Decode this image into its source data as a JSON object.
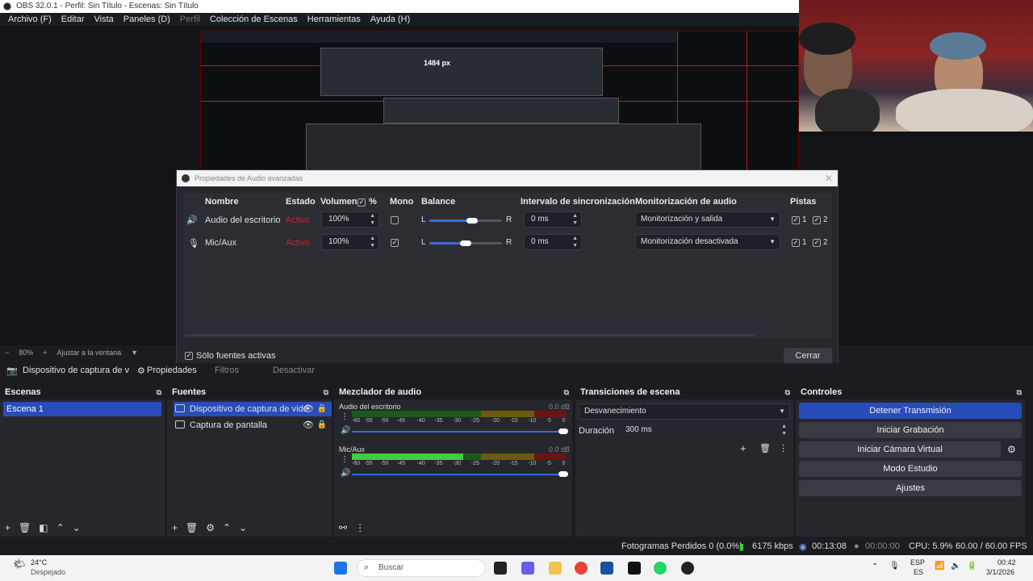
{
  "window": {
    "title": "OBS 32.0.1 - Perfil: Sin Título - Escenas: Sin Título"
  },
  "menu": [
    {
      "label": "Archivo (F)",
      "enabled": true
    },
    {
      "label": "Editar",
      "enabled": true
    },
    {
      "label": "Vista",
      "enabled": true
    },
    {
      "label": "Paneles (D)",
      "enabled": true
    },
    {
      "label": "Perfil",
      "enabled": false
    },
    {
      "label": "Colección de Escenas",
      "enabled": true
    },
    {
      "label": "Herramientas",
      "enabled": true
    },
    {
      "label": "Ayuda (H)",
      "enabled": true
    }
  ],
  "preview": {
    "nested_label": "1484 px",
    "zoom": "80%",
    "fit_label": "Ajustar a la ventana"
  },
  "audio_dialog": {
    "title": "Propiedades de Audio avanzadas",
    "columns": {
      "name": "Nombre",
      "state": "Estado",
      "volume": "Volumen",
      "percent": "%",
      "mono": "Mono",
      "balance": "Balance",
      "sync": "Intervalo de sincronización",
      "monitoring": "Monitorización de audio",
      "tracks": "Pistas"
    },
    "rows": [
      {
        "icon": "speaker-icon",
        "name": "Audio del escritorio",
        "state": "Activo",
        "volume": "100%",
        "mono": false,
        "balance_l": "L",
        "balance_r": "R",
        "balance": 0.5,
        "sync": "0 ms",
        "monitoring": "Monitorización y salida",
        "track1": "1",
        "track2": "2"
      },
      {
        "icon": "microphone-icon",
        "name": "Mic/Aux",
        "state": "Activo",
        "volume": "100%",
        "mono": true,
        "balance_l": "L",
        "balance_r": "R",
        "balance": 0.5,
        "sync": "0 ms",
        "monitoring": "Monitorización desactivada",
        "track1": "1",
        "track2": "2"
      }
    ],
    "only_active_label": "Sólo fuentes activas",
    "close_label": "Cerrar"
  },
  "source_toolbar": {
    "selected_source": "Dispositivo de captura de v",
    "properties": "Propiedades",
    "filters": "Filtros",
    "deactivate": "Desactivar"
  },
  "scenes": {
    "title": "Escenas",
    "items": [
      "Escena 1"
    ]
  },
  "sources": {
    "title": "Fuentes",
    "items": [
      {
        "name": "Dispositivo de captura de vide",
        "icon": "camera-icon"
      },
      {
        "name": "Captura de pantalla",
        "icon": "monitor-icon"
      }
    ]
  },
  "mixer": {
    "title": "Mezclador de audio",
    "ticks": [
      "-60",
      "-55",
      "-50",
      "-45",
      "-40",
      "-35",
      "-30",
      "-25",
      "-20",
      "-15",
      "-10",
      "-5",
      "0"
    ],
    "channels": [
      {
        "name": "Audio del escritorio",
        "db": "0.0 dB",
        "level": 0.0
      },
      {
        "name": "Mic/Aux",
        "db": "0.0 dB",
        "level": 0.52
      }
    ]
  },
  "transitions": {
    "title": "Transiciones de escena",
    "selected": "Desvanecimiento",
    "duration_label": "Duración",
    "duration_value": "300 ms"
  },
  "controls": {
    "title": "Controles",
    "stop_streaming": "Detener Transmisión",
    "start_recording": "Iniciar Grabación",
    "start_virtual_cam": "Iniciar Cámara Virtual",
    "studio_mode": "Modo Estudio",
    "settings": "Ajustes"
  },
  "status": {
    "dropped_frames": "Fotogramas Perdidos 0 (0.0%)",
    "bitrate": "6175 kbps",
    "stream_time": "00:13:08",
    "rec_time": "00:00:00",
    "cpu": "CPU: 5.9%",
    "fps": "60.00 / 60.00 FPS"
  },
  "taskbar": {
    "temperature": "24°C",
    "weather": "Despejado",
    "search_placeholder": "Buscar",
    "language": "ESP",
    "language_sub": "ES",
    "time": "00:42",
    "date": "3/1/2026"
  },
  "colors": {
    "accent": "#284cb8",
    "active_state": "#c0282d",
    "meter_green": "#3fce3f"
  }
}
